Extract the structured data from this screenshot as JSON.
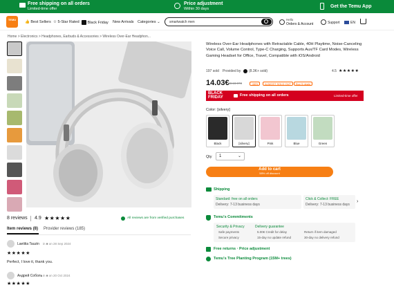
{
  "topbar": {
    "shipping_title": "Free shipping on all orders",
    "shipping_sub": "Limited-time offer",
    "price_title": "Price adjustment",
    "price_sub": "Within 30 days",
    "app": "Get the Temu App"
  },
  "header": {
    "logo": "TEMU",
    "nav": [
      "Best Sellers",
      "5-Star Rated",
      "Black Friday",
      "New Arrivals",
      "Categories"
    ],
    "search_value": "smartwatch men",
    "hello": "Hello",
    "account": "Orders & Account",
    "support": "Support",
    "lang": "EN"
  },
  "breadcrumb": "Home  >  Electronics  >  Headphones, Earbuds & Accessories  >  Wireless Over-Ear Headphon...",
  "product": {
    "title": "Wireless Over-Ear Headphones with Retractable Cable, 40H Playtime, Noise-Canceling Voice Call, Volume Control, Type-C Charging, Supports Aux/TF Card Modes, Wireless Gaming Headset for Office, Travel, Compatible with iOS/Android",
    "sold": "197 sold",
    "provided_by": "Provided by",
    "seller_rating": "(8.3K+ sold)",
    "rating": "4.5",
    "price": "14.03€",
    "original_price": "33.18.97€",
    "discount": "-58%",
    "almost_sold_out": "ALMOST SOLD OUT",
    "badge": "Buy 5 deals",
    "blackfriday_label": "BLACK FRIDAY",
    "blackfriday_text": "Free shipping on all orders",
    "blackfriday_right": "Limited-time offer",
    "color_label": "Color: [silvery]",
    "options": [
      {
        "label": "Black",
        "color": "#2a2a2a"
      },
      {
        "label": "[silvery]",
        "color": "#d8d8d8"
      },
      {
        "label": "Pink",
        "color": "#f2c6d0"
      },
      {
        "label": "Blue",
        "color": "#b8d8e0"
      },
      {
        "label": "Green",
        "color": "#c2dcc0"
      }
    ],
    "qty_label": "Qty",
    "qty_value": "1",
    "add_to_cart": "Add to cart",
    "add_to_cart_sub": "58% off discount"
  },
  "shipping": {
    "title": "Shipping",
    "standard": "Standard: free on all orders",
    "standard_delivery": "Delivery: 7-13 business days",
    "click": "Click & Collect: FREE",
    "click_delivery": "Delivery: 7-13 business days"
  },
  "commitments": {
    "title": "Temu's Commitments",
    "security_title": "Security & Privacy",
    "security": [
      "Safe payments",
      "Secure privacy"
    ],
    "delivery_title": "Delivery guarantee",
    "delivery": [
      "5.00€ Credit for delay",
      "15-day no update refund"
    ],
    "refund": [
      "Return if item damaged",
      "30-day no delivery refund"
    ],
    "free_returns": "Free returns · Price adjustment",
    "tree": "Temu's Tree Planting Program (15M+ trees)"
  },
  "reviews": {
    "count": "8 reviews",
    "score": "4.9",
    "verified": "All reviews are from verified purchases",
    "tab_item": "Item reviews (8)",
    "tab_provider": "Provider reviews (185)",
    "items": [
      {
        "name": "Laetitia Tauzin",
        "meta": "in ■ on 28 Sep 2024",
        "text": "Perfect, I love it, thank you."
      },
      {
        "name": "Андрей Соболь",
        "meta": "in ■ on 20 Oct 2024",
        "text": ""
      }
    ]
  }
}
